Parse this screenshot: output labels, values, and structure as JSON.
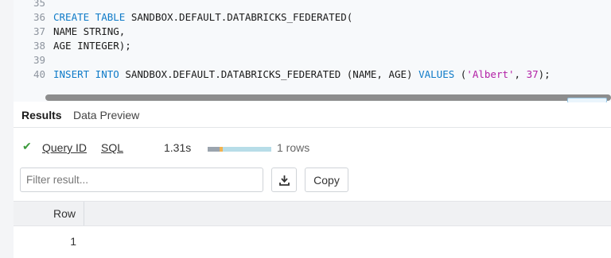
{
  "editor": {
    "lines": [
      {
        "num": "35"
      },
      {
        "num": "36",
        "a": "CREATE TABLE",
        "b": " SANDBOX.DEFAULT.DATABRICKS_FEDERATED("
      },
      {
        "num": "37",
        "b": "NAME STRING,"
      },
      {
        "num": "38",
        "b": "AGE INTEGER);"
      },
      {
        "num": "39"
      },
      {
        "num": "40",
        "a": "INSERT INTO",
        "b": " SANDBOX.DEFAULT.DATABRICKS_FEDERATED (NAME, AGE) ",
        "c": "VALUES",
        "d": " (",
        "e": "'Albert'",
        "f": ", ",
        "g": "37",
        "h": ");"
      }
    ]
  },
  "tabs": {
    "results": "Results",
    "preview": "Data Preview"
  },
  "status": {
    "query_id": "Query ID",
    "sql": "SQL",
    "duration": "1.31s",
    "rows": "1 rows",
    "check_icon": "check-icon"
  },
  "toolbar": {
    "filter_placeholder": "Filter result...",
    "copy_label": "Copy",
    "download_icon": "download-icon"
  },
  "table": {
    "header": "Row",
    "rows": [
      "1"
    ]
  }
}
